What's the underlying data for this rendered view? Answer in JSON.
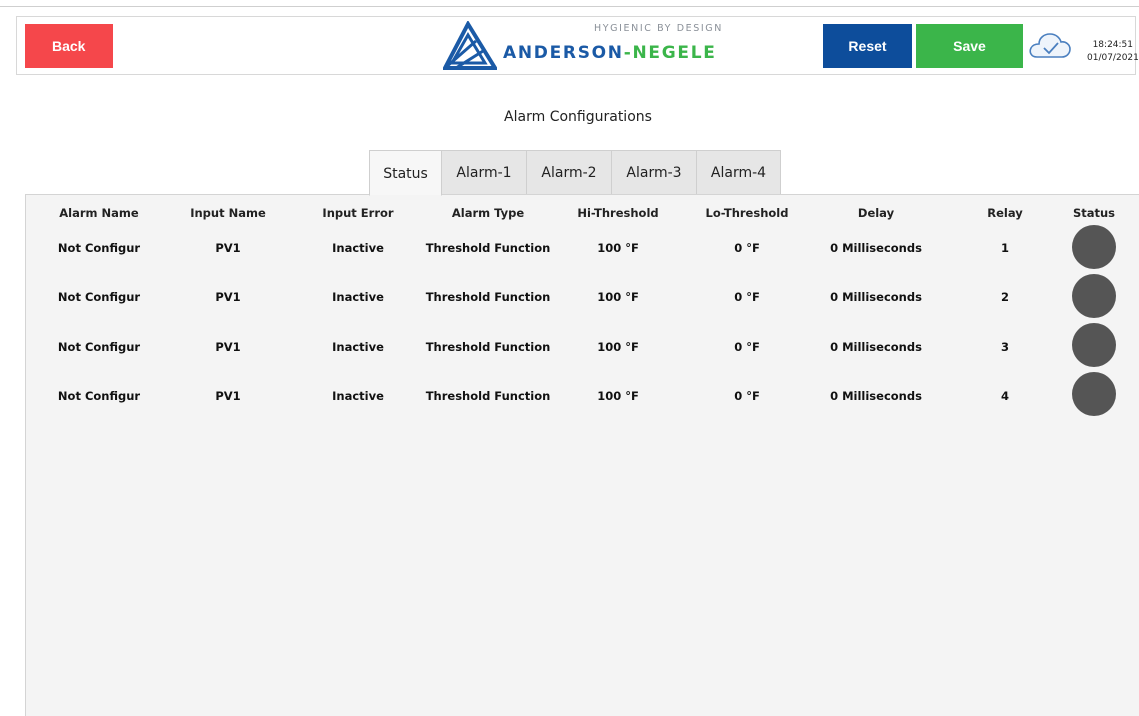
{
  "header": {
    "back_label": "Back",
    "reset_label": "Reset",
    "save_label": "Save",
    "logo": {
      "tagline": "HYGIENIC BY DESIGN",
      "name_part1": "ANDERSON",
      "name_sep": "-",
      "name_part2": "NEGELE",
      "primary_color": "#1b5aa6",
      "secondary_color": "#3bb54a"
    },
    "cloud_icon": "cloud-check-icon",
    "time": "18:24:51",
    "date": "01/07/2021"
  },
  "page_title": "Alarm Configurations",
  "tabs": [
    {
      "label": "Status",
      "active": true
    },
    {
      "label": "Alarm-1",
      "active": false
    },
    {
      "label": "Alarm-2",
      "active": false
    },
    {
      "label": "Alarm-3",
      "active": false
    },
    {
      "label": "Alarm-4",
      "active": false
    }
  ],
  "table": {
    "headers": [
      "Alarm Name",
      "Input Name",
      "Input Error",
      "Alarm Type",
      "Hi-Threshold",
      "Lo-Threshold",
      "Delay",
      "Relay",
      "Status"
    ],
    "rows": [
      {
        "alarm_name": "Not Configur",
        "input_name": "PV1",
        "input_error": "Inactive",
        "alarm_type": "Threshold Function",
        "hi": "100 °F",
        "lo": "0 °F",
        "delay": "0 Milliseconds",
        "relay": "1",
        "status_color": "#555555"
      },
      {
        "alarm_name": "Not Configur",
        "input_name": "PV1",
        "input_error": "Inactive",
        "alarm_type": "Threshold Function",
        "hi": "100 °F",
        "lo": "0 °F",
        "delay": "0 Milliseconds",
        "relay": "2",
        "status_color": "#555555"
      },
      {
        "alarm_name": "Not Configur",
        "input_name": "PV1",
        "input_error": "Inactive",
        "alarm_type": "Threshold Function",
        "hi": "100 °F",
        "lo": "0 °F",
        "delay": "0 Milliseconds",
        "relay": "3",
        "status_color": "#555555"
      },
      {
        "alarm_name": "Not Configur",
        "input_name": "PV1",
        "input_error": "Inactive",
        "alarm_type": "Threshold Function",
        "hi": "100 °F",
        "lo": "0 °F",
        "delay": "0 Milliseconds",
        "relay": "4",
        "status_color": "#555555"
      }
    ]
  },
  "colors": {
    "back": "#f5474b",
    "reset": "#0d4d9b",
    "save": "#3bb54a",
    "panel_bg": "#f4f4f4"
  }
}
